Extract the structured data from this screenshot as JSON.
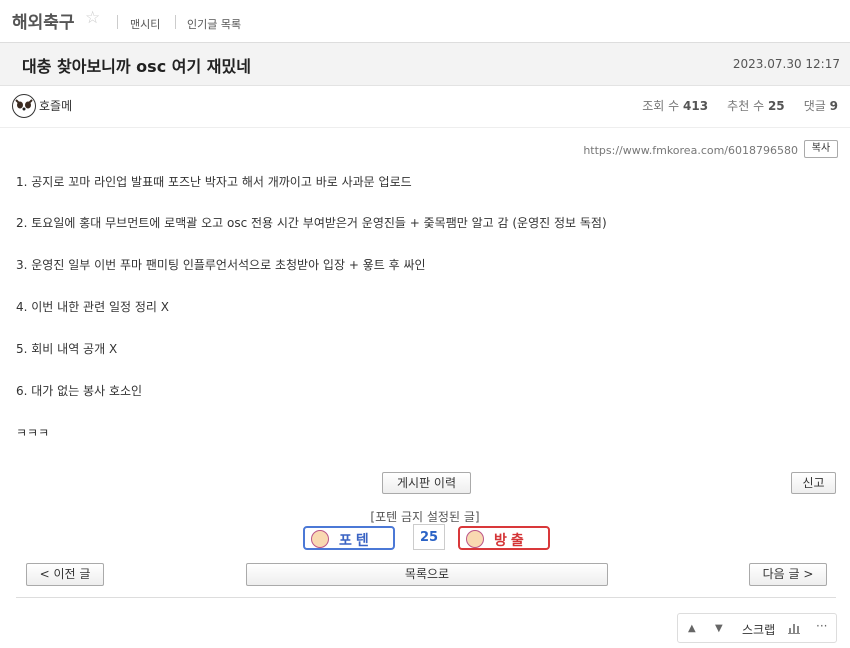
{
  "header": {
    "board_title": "해외축구",
    "star_icon": "☆",
    "links": [
      "맨시티",
      "인기글 목록"
    ]
  },
  "post": {
    "title": "대충 찾아보니까 osc 여기 재밌네",
    "date": "2023.07.30 12:17",
    "author": "호즐메",
    "stats": {
      "views_label": "조회 수",
      "views": "413",
      "recommend_label": "추천 수",
      "recommend": "25",
      "comments_label": "댓글",
      "comments": "9"
    },
    "url": "https://www.fmkorea.com/6018796580",
    "copy_label": "복사",
    "lines": [
      "1. 공지로 꼬마 라인업 발표때 포즈난 박자고 해서 개까이고 바로 사과문 업로드",
      "2. 토요일에 홍대 무브먼트에 로맥괄 오고 osc 전용 시간 부여받은거 운영진들 + 줒목팸만 알고 감 (운영진 정보 독점)",
      "3. 운영진 일부 이번 푸마 팬미팅 인플루언서석으로 초청받아 입장 + 욯트 후 싸인",
      "4. 이번 내한 관련 일정 정리 X",
      "5. 회비 내역 공개 X",
      "6. 대가 없는 봉사 호소인",
      "ㅋㅋㅋ"
    ]
  },
  "actions": {
    "history_label": "게시판 이력",
    "report_label": "신고",
    "notice": "[포텐 금지 설정된 글]",
    "vote_up_label": "포텐",
    "vote_count": "25",
    "vote_down_label": "방출",
    "prev_label": "< 이전 글",
    "list_label": "목록으로",
    "next_label": "다음 글 >"
  },
  "toolbar": {
    "up_icon": "▲",
    "down_icon": "▼",
    "scrap_label": "스크랩",
    "more_icon": "···"
  }
}
